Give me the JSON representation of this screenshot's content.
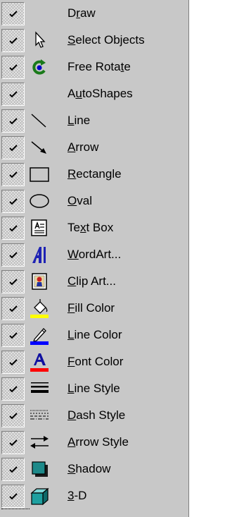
{
  "menu": {
    "items": [
      {
        "id": "draw",
        "pre": "D",
        "key": "r",
        "post": "aw",
        "checked": true,
        "icon": "none"
      },
      {
        "id": "select-objects",
        "pre": "",
        "key": "S",
        "post": "elect Objects",
        "checked": true,
        "icon": "arrow-cursor-icon"
      },
      {
        "id": "free-rotate",
        "pre": "Free Rota",
        "key": "t",
        "post": "e",
        "checked": true,
        "icon": "free-rotate-icon"
      },
      {
        "id": "autoshapes",
        "pre": "A",
        "key": "u",
        "post": "toShapes",
        "checked": true,
        "icon": "none"
      },
      {
        "id": "line",
        "pre": "",
        "key": "L",
        "post": "ine",
        "checked": true,
        "icon": "line-icon"
      },
      {
        "id": "arrow",
        "pre": "",
        "key": "A",
        "post": "rrow",
        "checked": true,
        "icon": "arrow-icon"
      },
      {
        "id": "rectangle",
        "pre": "",
        "key": "R",
        "post": "ectangle",
        "checked": true,
        "icon": "rectangle-icon"
      },
      {
        "id": "oval",
        "pre": "",
        "key": "O",
        "post": "val",
        "checked": true,
        "icon": "oval-icon"
      },
      {
        "id": "text-box",
        "pre": "Te",
        "key": "x",
        "post": "t Box",
        "checked": true,
        "icon": "text-box-icon"
      },
      {
        "id": "wordart",
        "pre": "",
        "key": "W",
        "post": "ordArt...",
        "checked": true,
        "icon": "wordart-icon"
      },
      {
        "id": "clip-art",
        "pre": "",
        "key": "C",
        "post": "lip Art...",
        "checked": true,
        "icon": "clip-art-icon"
      },
      {
        "id": "fill-color",
        "pre": "",
        "key": "F",
        "post": "ill Color",
        "checked": true,
        "icon": "fill-color-icon"
      },
      {
        "id": "line-color",
        "pre": "",
        "key": "L",
        "post": "ine Color",
        "checked": true,
        "icon": "line-color-icon"
      },
      {
        "id": "font-color",
        "pre": "",
        "key": "F",
        "post": "ont Color",
        "checked": true,
        "icon": "font-color-icon"
      },
      {
        "id": "line-style",
        "pre": "",
        "key": "L",
        "post": "ine Style",
        "checked": true,
        "icon": "line-style-icon"
      },
      {
        "id": "dash-style",
        "pre": "",
        "key": "D",
        "post": "ash Style",
        "checked": true,
        "icon": "dash-style-icon"
      },
      {
        "id": "arrow-style",
        "pre": "",
        "key": "A",
        "post": "rrow Style",
        "checked": true,
        "icon": "arrow-style-icon"
      },
      {
        "id": "shadow",
        "pre": "",
        "key": "S",
        "post": "hadow",
        "checked": true,
        "icon": "shadow-icon"
      },
      {
        "id": "3-d",
        "pre": "",
        "key": "3",
        "post": "-D",
        "checked": true,
        "icon": "3d-icon"
      }
    ]
  },
  "colors": {
    "menu_background": "#c8c8c8",
    "fill_color_swatch": "#ffff00",
    "line_color_swatch": "#0000ff",
    "font_color_swatch": "#ff0000"
  }
}
